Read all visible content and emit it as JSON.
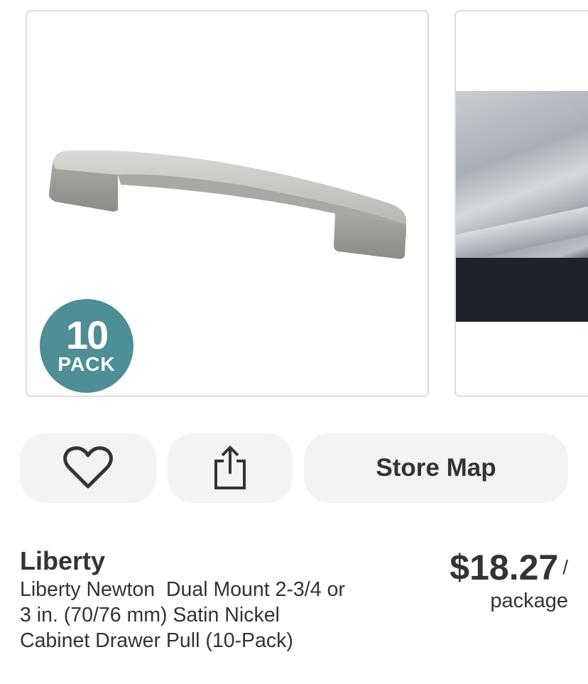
{
  "gallery": {
    "main_image": {
      "alt": "Satin nickel cabinet drawer pull",
      "badge_number": "10",
      "badge_text": "PACK",
      "badge_color": "#4e8e95"
    },
    "next_image": {
      "alt": "Marble countertop with dark cabinet"
    }
  },
  "actions": {
    "favorite_icon": "heart-outline-icon",
    "share_icon": "share-icon",
    "store_map_label": "Store Map"
  },
  "product": {
    "brand": "Liberty",
    "title": "Liberty Newton  Dual Mount 2-3/4 or 3 in. (70/76 mm) Satin Nickel Cabinet Drawer Pull (10-Pack)",
    "price": "$18.27",
    "price_separator": "/",
    "unit": "package"
  }
}
